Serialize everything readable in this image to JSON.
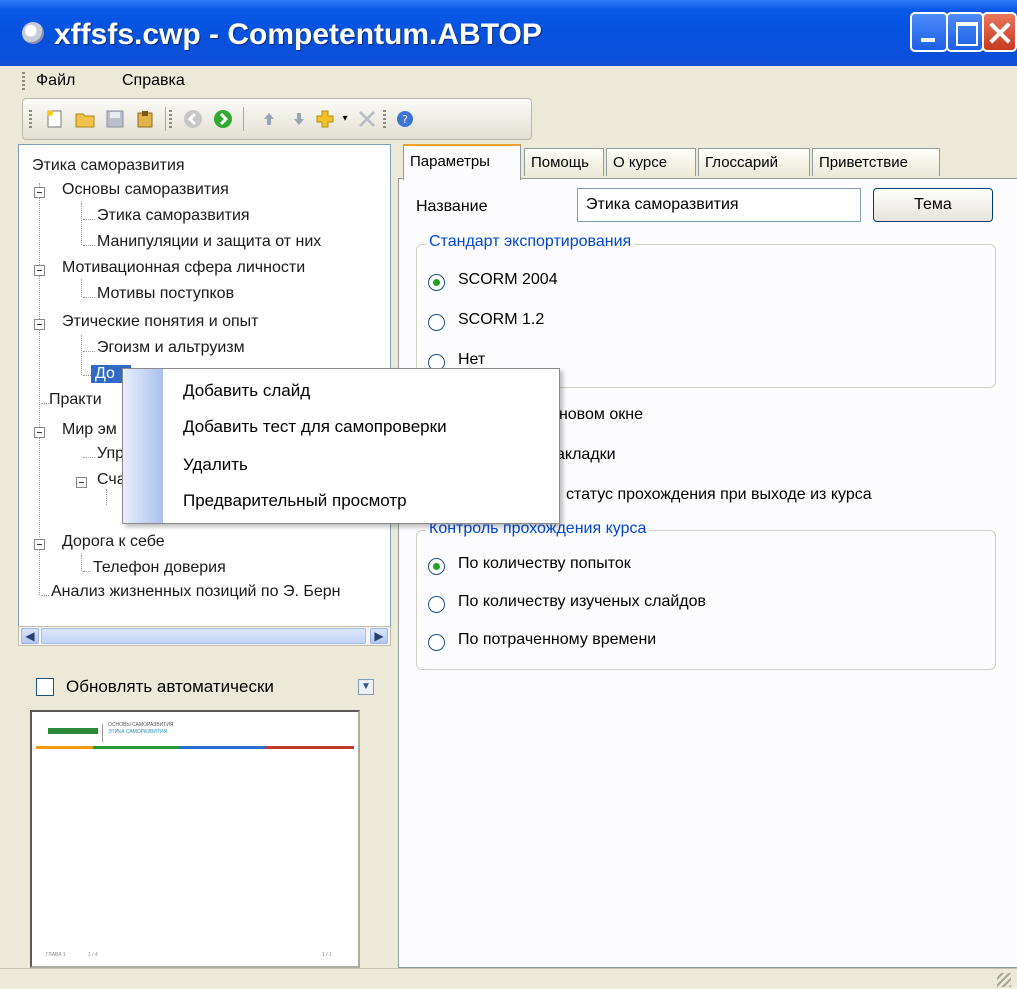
{
  "window": {
    "title": "xffsfs.cwp - Competentum.ABTOP"
  },
  "menu": {
    "items": [
      "Файл",
      "Справка"
    ]
  },
  "toolbar": {
    "icons": [
      "new-file-icon",
      "open-folder-icon",
      "save-icon",
      "package-icon",
      "back-icon",
      "forward-icon",
      "move-up-icon",
      "move-down-icon",
      "add-icon",
      "delete-icon",
      "help-icon"
    ]
  },
  "tree": {
    "root": "Этика саморазвития",
    "items": [
      {
        "label": "Основы саморазвития"
      },
      {
        "label": "Этика саморазвития"
      },
      {
        "label": "Манипуляции и защита от них"
      },
      {
        "label": "Мотивационная сфера личности"
      },
      {
        "label": "Мотивы поступков"
      },
      {
        "label": "Этические понятия и опыт"
      },
      {
        "label": "Эгоизм и альтруизм"
      },
      {
        "label": "До"
      },
      {
        "label": "Практи"
      },
      {
        "label": "Мир эм"
      },
      {
        "label": "Упр"
      },
      {
        "label": "Сча"
      },
      {
        "label": "Дорога к себе"
      },
      {
        "label": "Телефон доверия"
      },
      {
        "label": "Анализ жизненных позиций по Э. Берн"
      }
    ]
  },
  "auto_update": {
    "label": "Обновлять автоматически",
    "checked": false
  },
  "preview": {
    "header_line1": "ОСНОВЫ САМОРАЗВИТИЯ",
    "header_line2": "ЭТИКА САМОРАЗВИТИЯ",
    "footer_left": "ГЛАВА 1",
    "footer_mid": "1 / 4",
    "footer_right": "1 / 1"
  },
  "tabs": [
    "Параметры",
    "Помощь",
    "О курсе",
    "Глоссарий",
    "Приветствие"
  ],
  "params": {
    "name_label": "Название",
    "name_value": "Этика саморазвития",
    "theme_button": "Тема",
    "export_group_title": "Стандарт экспортирования",
    "export_options": [
      {
        "label": "SCORM 2004",
        "selected": true
      },
      {
        "label": "SCORM 1.2",
        "selected": false
      },
      {
        "label": "Нет",
        "selected": false
      }
    ],
    "option_new_window": "в новом окне",
    "option_tabs": "акладки",
    "option_status": "статус прохождения при выходе из курса",
    "control_group_title": "Контроль прохождения курса",
    "control_options": [
      {
        "label": "По количеству попыток",
        "selected": true
      },
      {
        "label": "По количеству изученых слайдов",
        "selected": false
      },
      {
        "label": "По потраченному времени",
        "selected": false
      }
    ]
  },
  "context_menu": {
    "items": [
      "Добавить слайд",
      "Добавить тест для самопроверки",
      "Удалить",
      "Предварительный просмотр"
    ]
  },
  "colors": {
    "titlebar": "#0552de",
    "selection": "#316ac5",
    "group_title": "#0046d5",
    "radio_dot": "#21a121"
  }
}
